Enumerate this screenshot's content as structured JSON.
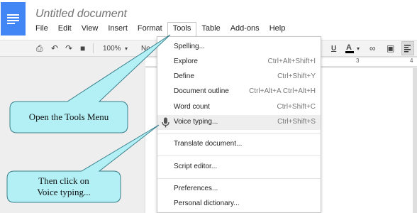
{
  "header": {
    "doc_title": "Untitled document",
    "menu": [
      "File",
      "Edit",
      "View",
      "Insert",
      "Format",
      "Tools",
      "Table",
      "Add-ons",
      "Help"
    ],
    "active_menu": "Tools"
  },
  "toolbar": {
    "zoom": "100%",
    "style_partial": "No",
    "underline_label": "U",
    "text_color_label": "A",
    "colors": {
      "toolbar_bg": "#f3f3f3",
      "logo": "#4285f4"
    }
  },
  "ruler": {
    "marks": [
      "3",
      "4"
    ]
  },
  "tools_menu": {
    "items": [
      {
        "label": "Spelling...",
        "shortcut": ""
      },
      {
        "label": "Explore",
        "shortcut": "Ctrl+Alt+Shift+I"
      },
      {
        "label": "Define",
        "shortcut": "Ctrl+Shift+Y"
      },
      {
        "label": "Document outline",
        "shortcut": "Ctrl+Alt+A Ctrl+Alt+H"
      },
      {
        "label": "Word count",
        "shortcut": "Ctrl+Shift+C"
      },
      {
        "label": "Voice typing...",
        "shortcut": "Ctrl+Shift+S",
        "highlighted": true,
        "icon": "microphone-icon"
      },
      {
        "label": "Translate document...",
        "shortcut": ""
      },
      {
        "label": "Script editor...",
        "shortcut": ""
      },
      {
        "label": "Preferences...",
        "shortcut": ""
      },
      {
        "label": "Personal dictionary...",
        "shortcut": ""
      }
    ]
  },
  "callouts": {
    "first": "Open the Tools Menu",
    "second_line1": "Then click on",
    "second_line2": "Voice typing...",
    "fill_color": "#b2f0f5",
    "stroke_color": "#3a7f8c"
  }
}
